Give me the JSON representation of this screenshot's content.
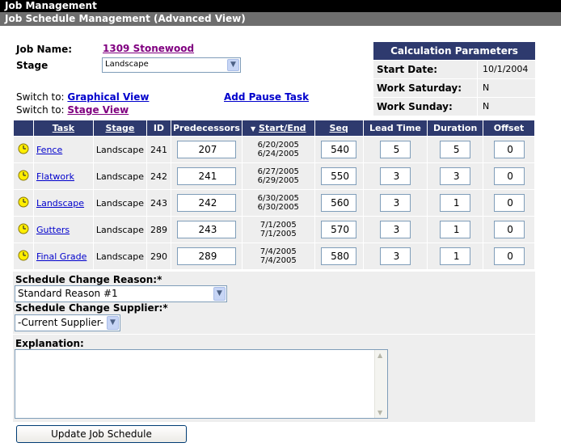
{
  "header": {
    "title": "Job Management",
    "subtitle": "Job Schedule Management (Advanced View)"
  },
  "job": {
    "name_label": "Job Name:",
    "name_value": "1309 Stonewood",
    "stage_label": "Stage",
    "stage_value": "Landscape"
  },
  "links": {
    "switch_to_1": "Switch to:",
    "graphical_view": "Graphical View",
    "switch_to_2": "Switch to:",
    "stage_view": "Stage View",
    "add_pause_task": "Add Pause Task"
  },
  "calc": {
    "title": "Calculation Parameters",
    "start_date_label": "Start Date:",
    "start_date_value": "10/1/2004",
    "work_saturday_label": "Work Saturday:",
    "work_saturday_value": "N",
    "work_sunday_label": "Work Sunday:",
    "work_sunday_value": "N"
  },
  "table": {
    "headers": {
      "task": "Task",
      "stage": "Stage",
      "id": "ID",
      "predecessors": "Predecessors",
      "start_end": "Start/End",
      "seq": "Seq",
      "lead_time": "Lead Time",
      "duration": "Duration",
      "offset": "Offset"
    },
    "rows": [
      {
        "task": "Fence",
        "stage": "Landscape",
        "id": "241",
        "pred": "207",
        "start": "6/20/2005",
        "end": "6/24/2005",
        "seq": "540",
        "lead": "5",
        "duration": "5",
        "offset": "0"
      },
      {
        "task": "Flatwork",
        "stage": "Landscape",
        "id": "242",
        "pred": "241",
        "start": "6/27/2005",
        "end": "6/29/2005",
        "seq": "550",
        "lead": "3",
        "duration": "3",
        "offset": "0"
      },
      {
        "task": "Landscape",
        "stage": "Landscape",
        "id": "243",
        "pred": "242",
        "start": "6/30/2005",
        "end": "6/30/2005",
        "seq": "560",
        "lead": "3",
        "duration": "1",
        "offset": "0"
      },
      {
        "task": "Gutters",
        "stage": "Landscape",
        "id": "289",
        "pred": "243",
        "start": "7/1/2005",
        "end": "7/1/2005",
        "seq": "570",
        "lead": "3",
        "duration": "1",
        "offset": "0"
      },
      {
        "task": "Final Grade",
        "stage": "Landscape",
        "id": "290",
        "pred": "289",
        "start": "7/4/2005",
        "end": "7/4/2005",
        "seq": "580",
        "lead": "3",
        "duration": "1",
        "offset": "0"
      }
    ]
  },
  "form": {
    "reason_label": "Schedule Change Reason:*",
    "reason_value": "Standard Reason #1",
    "supplier_label": "Schedule Change Supplier:*",
    "supplier_value": "-Current Supplier-",
    "explanation_label": "Explanation:",
    "explanation_value": ""
  },
  "update_button": "Update Job Schedule",
  "colors": {
    "header_navy": "#2e3a6e",
    "link_purple": "#800080",
    "link_blue": "#0000cc",
    "row_gray": "#eeeeee",
    "clock_yellow": "#ffee00"
  }
}
